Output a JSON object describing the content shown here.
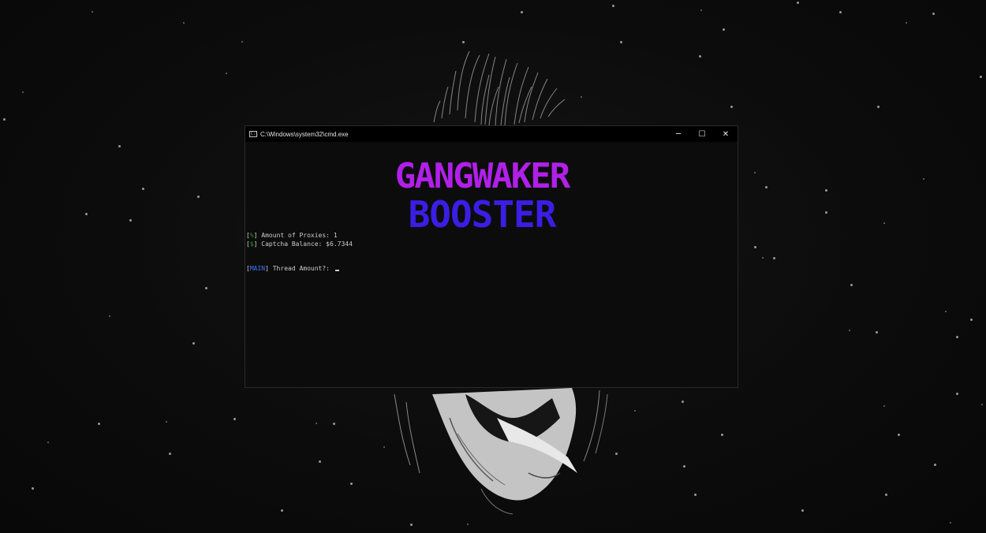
{
  "window": {
    "title": "C:\\Windows\\system32\\cmd.exe",
    "icon": "cmd-icon",
    "icon_glyph": "C:\\",
    "controls": {
      "minimize": "─",
      "maximize": "☐",
      "close": "✕"
    }
  },
  "banner": {
    "line1": "GANGWAKER",
    "line2": "BOOSTER",
    "line1_color": "#b020e8",
    "line2_color": "#3a1ee6"
  },
  "console": {
    "proxies": {
      "bracket_open": "[",
      "symbol": "%",
      "bracket_close": "]",
      "text": " Amount of Proxies: 1"
    },
    "captcha": {
      "bracket_open": "[",
      "symbol": "$",
      "bracket_close": "]",
      "text": " Captcha Balance: $6.7344"
    },
    "prompt": {
      "bracket_open": "[",
      "tag": "MAIN",
      "bracket_close": "]",
      "text": " Thread Amount?: ",
      "input_value": ""
    }
  },
  "colors": {
    "terminal_bg": "#0c0c0c",
    "terminal_text": "#cccccc",
    "accent_green": "#13a10e",
    "accent_blue": "#3b78ff"
  }
}
